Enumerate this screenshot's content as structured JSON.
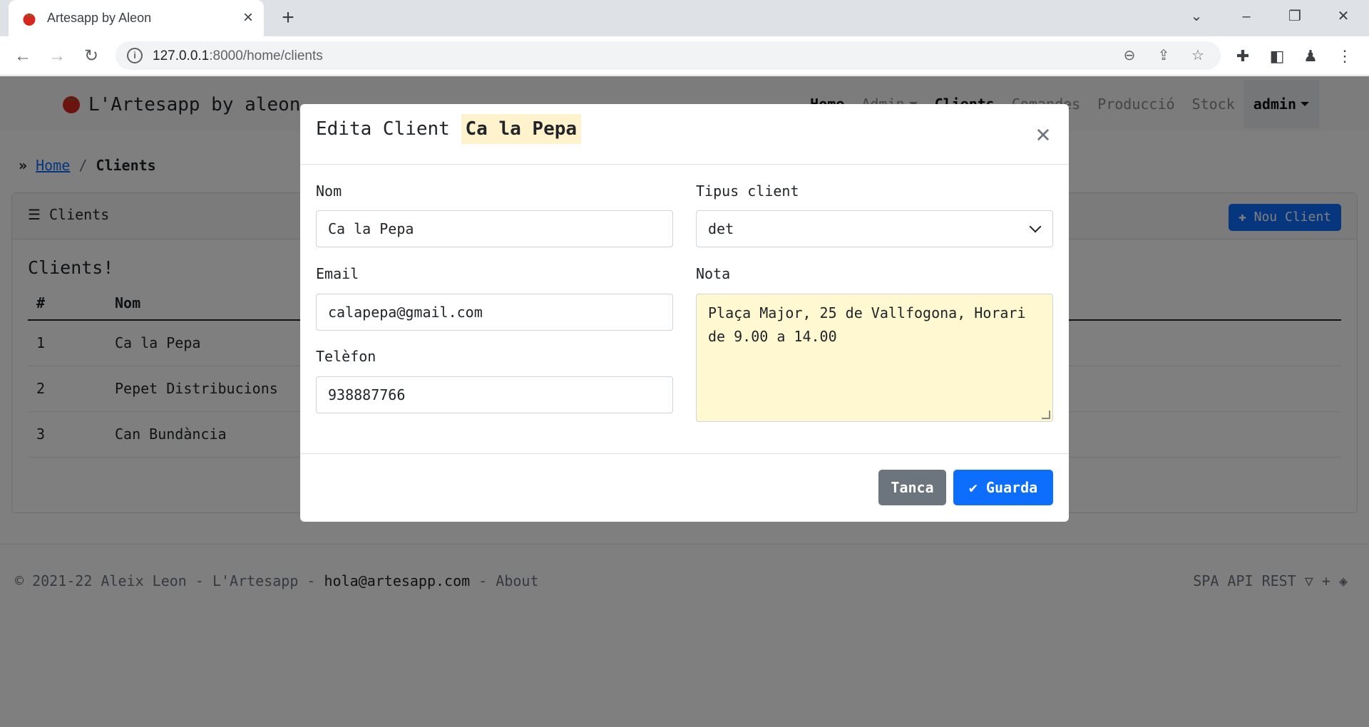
{
  "browser": {
    "tab_title": "Artesapp by Aleon",
    "url_host": "127.0.0.1",
    "url_path": ":8000/home/clients"
  },
  "app": {
    "brand": "L'Artesapp by aleon",
    "nav": [
      {
        "label": "Home",
        "active": true
      },
      {
        "label": "Admin",
        "active": false
      },
      {
        "label": "Clients",
        "active": true
      },
      {
        "label": "Comandes",
        "active": false
      },
      {
        "label": "Producció",
        "active": false
      },
      {
        "label": "Stock",
        "active": false
      }
    ],
    "user_menu": "admin"
  },
  "breadcrumb": {
    "home": "Home",
    "separator": "/",
    "current": "Clients"
  },
  "card": {
    "title": "Clients",
    "new_button": "Nou Client",
    "heading": "Clients!",
    "columns": [
      "#",
      "Nom"
    ],
    "rows": [
      {
        "id": "1",
        "name": "Ca la Pepa"
      },
      {
        "id": "2",
        "name": "Pepet Distribucions"
      },
      {
        "id": "3",
        "name": "Can Bundància"
      }
    ]
  },
  "footer": {
    "left_prefix": "© 2021-22 Aleix Leon - L'Artesapp - ",
    "email": "hola@artesapp.com",
    "left_suffix": " - About",
    "right": "SPA API REST"
  },
  "modal": {
    "title": "Edita Client",
    "title_name": "Ca la Pepa",
    "fields": {
      "nom_label": "Nom",
      "nom_value": "Ca la Pepa",
      "email_label": "Email",
      "email_value": "calapepa@gmail.com",
      "telefon_label": "Telèfon",
      "telefon_value": "938887766",
      "tipus_label": "Tipus client",
      "tipus_value": "det",
      "nota_label": "Nota",
      "nota_value": "Plaça Major, 25 de Vallfogona, Horari de 9.00 a 14.00"
    },
    "close_button": "Tanca",
    "save_button": "Guarda"
  },
  "colors": {
    "primary": "#0d6efd",
    "secondary": "#6c757d",
    "highlight": "#fff3cd",
    "textarea_bg": "#fff8d0"
  }
}
